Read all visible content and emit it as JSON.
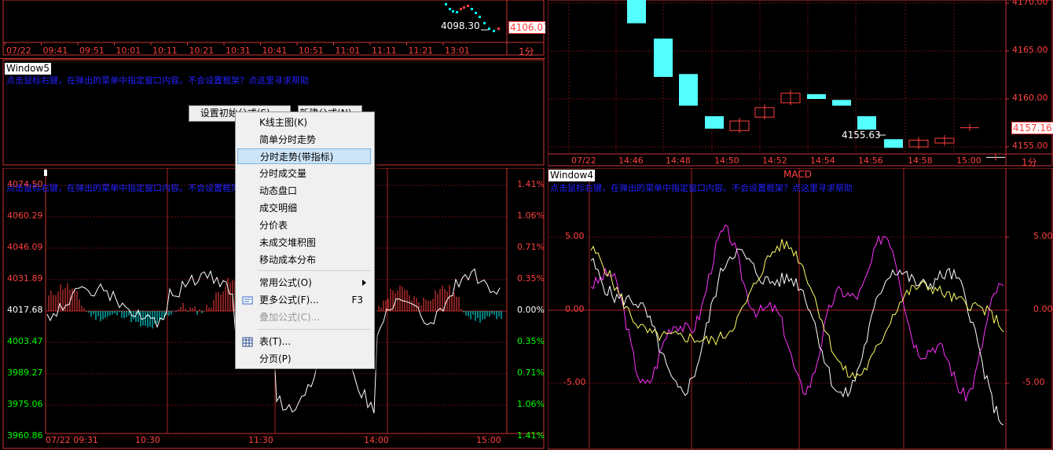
{
  "window_tl": {
    "callout_label": "4098.30",
    "price_tag": "4106.07",
    "period": "1分",
    "time_labels": [
      "07/22",
      "09:41",
      "09:51",
      "10:01",
      "10:11",
      "10:21",
      "10:31",
      "10:41",
      "10:51",
      "11:01",
      "11:11",
      "11:21",
      "13:01"
    ]
  },
  "window5": {
    "title": "Window5",
    "help_text": "点击鼠标右键，在弹出的菜单中指定窗口内容。不会设置框架？点这里寻求帮助",
    "btn_init": "设置初始分式(S)...",
    "btn_new": "新建公式(N)..."
  },
  "window_tr": {
    "callout_label": "4155.63",
    "price_tag": "4157.16",
    "period": "1分",
    "y_labels": [
      "4170.00",
      "4165.00",
      "4160.00",
      "4155.00"
    ],
    "time_labels": [
      "07/22",
      "14:46",
      "14:48",
      "14:50",
      "14:52",
      "14:54",
      "14:56",
      "14:58",
      "15:00"
    ]
  },
  "window_bl": {
    "help_text": "点击鼠标右键，在弹出的菜单中指定窗口内容。不会设置框架？点这里寻求帮助",
    "price_labels": [
      "4074.50",
      "4060.29",
      "4046.09",
      "4031.89",
      "4017.68",
      "4003.47",
      "3989.27",
      "3975.06",
      "3960.86"
    ],
    "pct_labels": [
      "1.41%",
      "1.06%",
      "0.71%",
      "0.35%",
      "0.00%",
      "0.35%",
      "0.71%",
      "1.06%",
      "1.41%"
    ],
    "time_labels": [
      "07/22 09:31",
      "10:30",
      "11:30",
      "14:00",
      "15:00"
    ],
    "colors": {
      "up": "#ff4040",
      "down": "#00ff00",
      "flat": "#ffffff"
    }
  },
  "window4": {
    "title": "Window4",
    "indicator": "MACD",
    "help_text": "点击鼠标右键，在弹出的菜单中指定窗口内容。不会设置框架？点这里寻求帮助",
    "y_labels": [
      "5.00",
      "0.00",
      "-5.00"
    ]
  },
  "context_menu": {
    "items": [
      {
        "label": "K线主图(K)",
        "shortcut": "",
        "disabled": false,
        "selected": false
      },
      {
        "label": "简单分时走势",
        "shortcut": "",
        "disabled": false,
        "selected": false
      },
      {
        "label": "分时走势(带指标)",
        "shortcut": "",
        "disabled": false,
        "selected": true
      },
      {
        "label": "分时成交量",
        "shortcut": "",
        "disabled": false,
        "selected": false
      },
      {
        "label": "动态盘口",
        "shortcut": "",
        "disabled": false,
        "selected": false
      },
      {
        "label": "成交明细",
        "shortcut": "",
        "disabled": false,
        "selected": false
      },
      {
        "label": "分价表",
        "shortcut": "",
        "disabled": false,
        "selected": false
      },
      {
        "label": "未成交堆积图",
        "shortcut": "",
        "disabled": false,
        "selected": false
      },
      {
        "label": "移动成本分布",
        "shortcut": "",
        "disabled": false,
        "selected": false
      },
      {
        "label": "常用公式(O)",
        "shortcut": "",
        "disabled": false,
        "selected": false
      },
      {
        "label": "更多公式(F)...",
        "shortcut": "F3",
        "disabled": false,
        "selected": false
      },
      {
        "label": "叠加公式(C)...",
        "shortcut": "",
        "disabled": true,
        "selected": false
      },
      {
        "label": "表(T)...",
        "shortcut": "",
        "disabled": false,
        "selected": false
      },
      {
        "label": "分页(P)",
        "shortcut": "",
        "disabled": false,
        "selected": false
      }
    ]
  }
}
